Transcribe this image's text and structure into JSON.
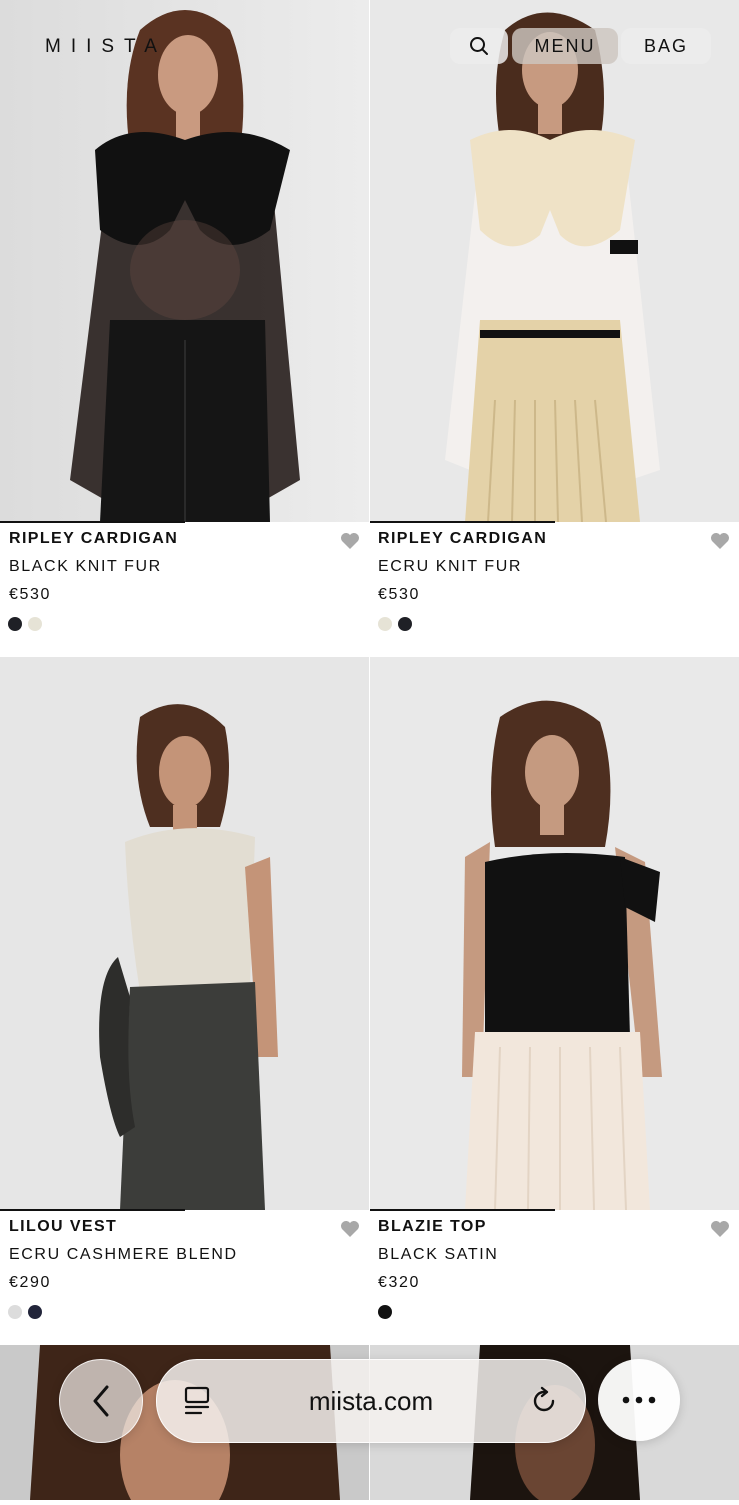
{
  "header": {
    "logo": "MIISTA",
    "menu_label": "MENU",
    "bag_label": "BAG",
    "search_icon": "search-icon"
  },
  "products": [
    {
      "name": "RIPLEY CARDIGAN",
      "color": "BLACK KNIT FUR",
      "price": "€530",
      "swatches": [
        "#1f2026",
        "#e6e3d6"
      ]
    },
    {
      "name": "RIPLEY CARDIGAN",
      "color": "ECRU KNIT FUR",
      "price": "€530",
      "swatches": [
        "#e6e3d6",
        "#1f2026"
      ]
    },
    {
      "name": "LILOU VEST",
      "color": "ECRU CASHMERE BLEND",
      "price": "€290",
      "swatches": [
        "#dcdcdc",
        "#22253a"
      ]
    },
    {
      "name": "BLAZIE TOP",
      "color": "BLACK SATIN",
      "price": "€320",
      "swatches": [
        "#111111"
      ]
    }
  ],
  "browser": {
    "url": "miista.com",
    "back_icon": "chevron-left-icon",
    "tabs_icon": "tabs-icon",
    "reload_icon": "reload-icon",
    "more_icon": "more-icon"
  },
  "colors": {
    "text": "#111111",
    "heart": "#a8a8a8",
    "photo_bg": "#e9e9e9"
  }
}
